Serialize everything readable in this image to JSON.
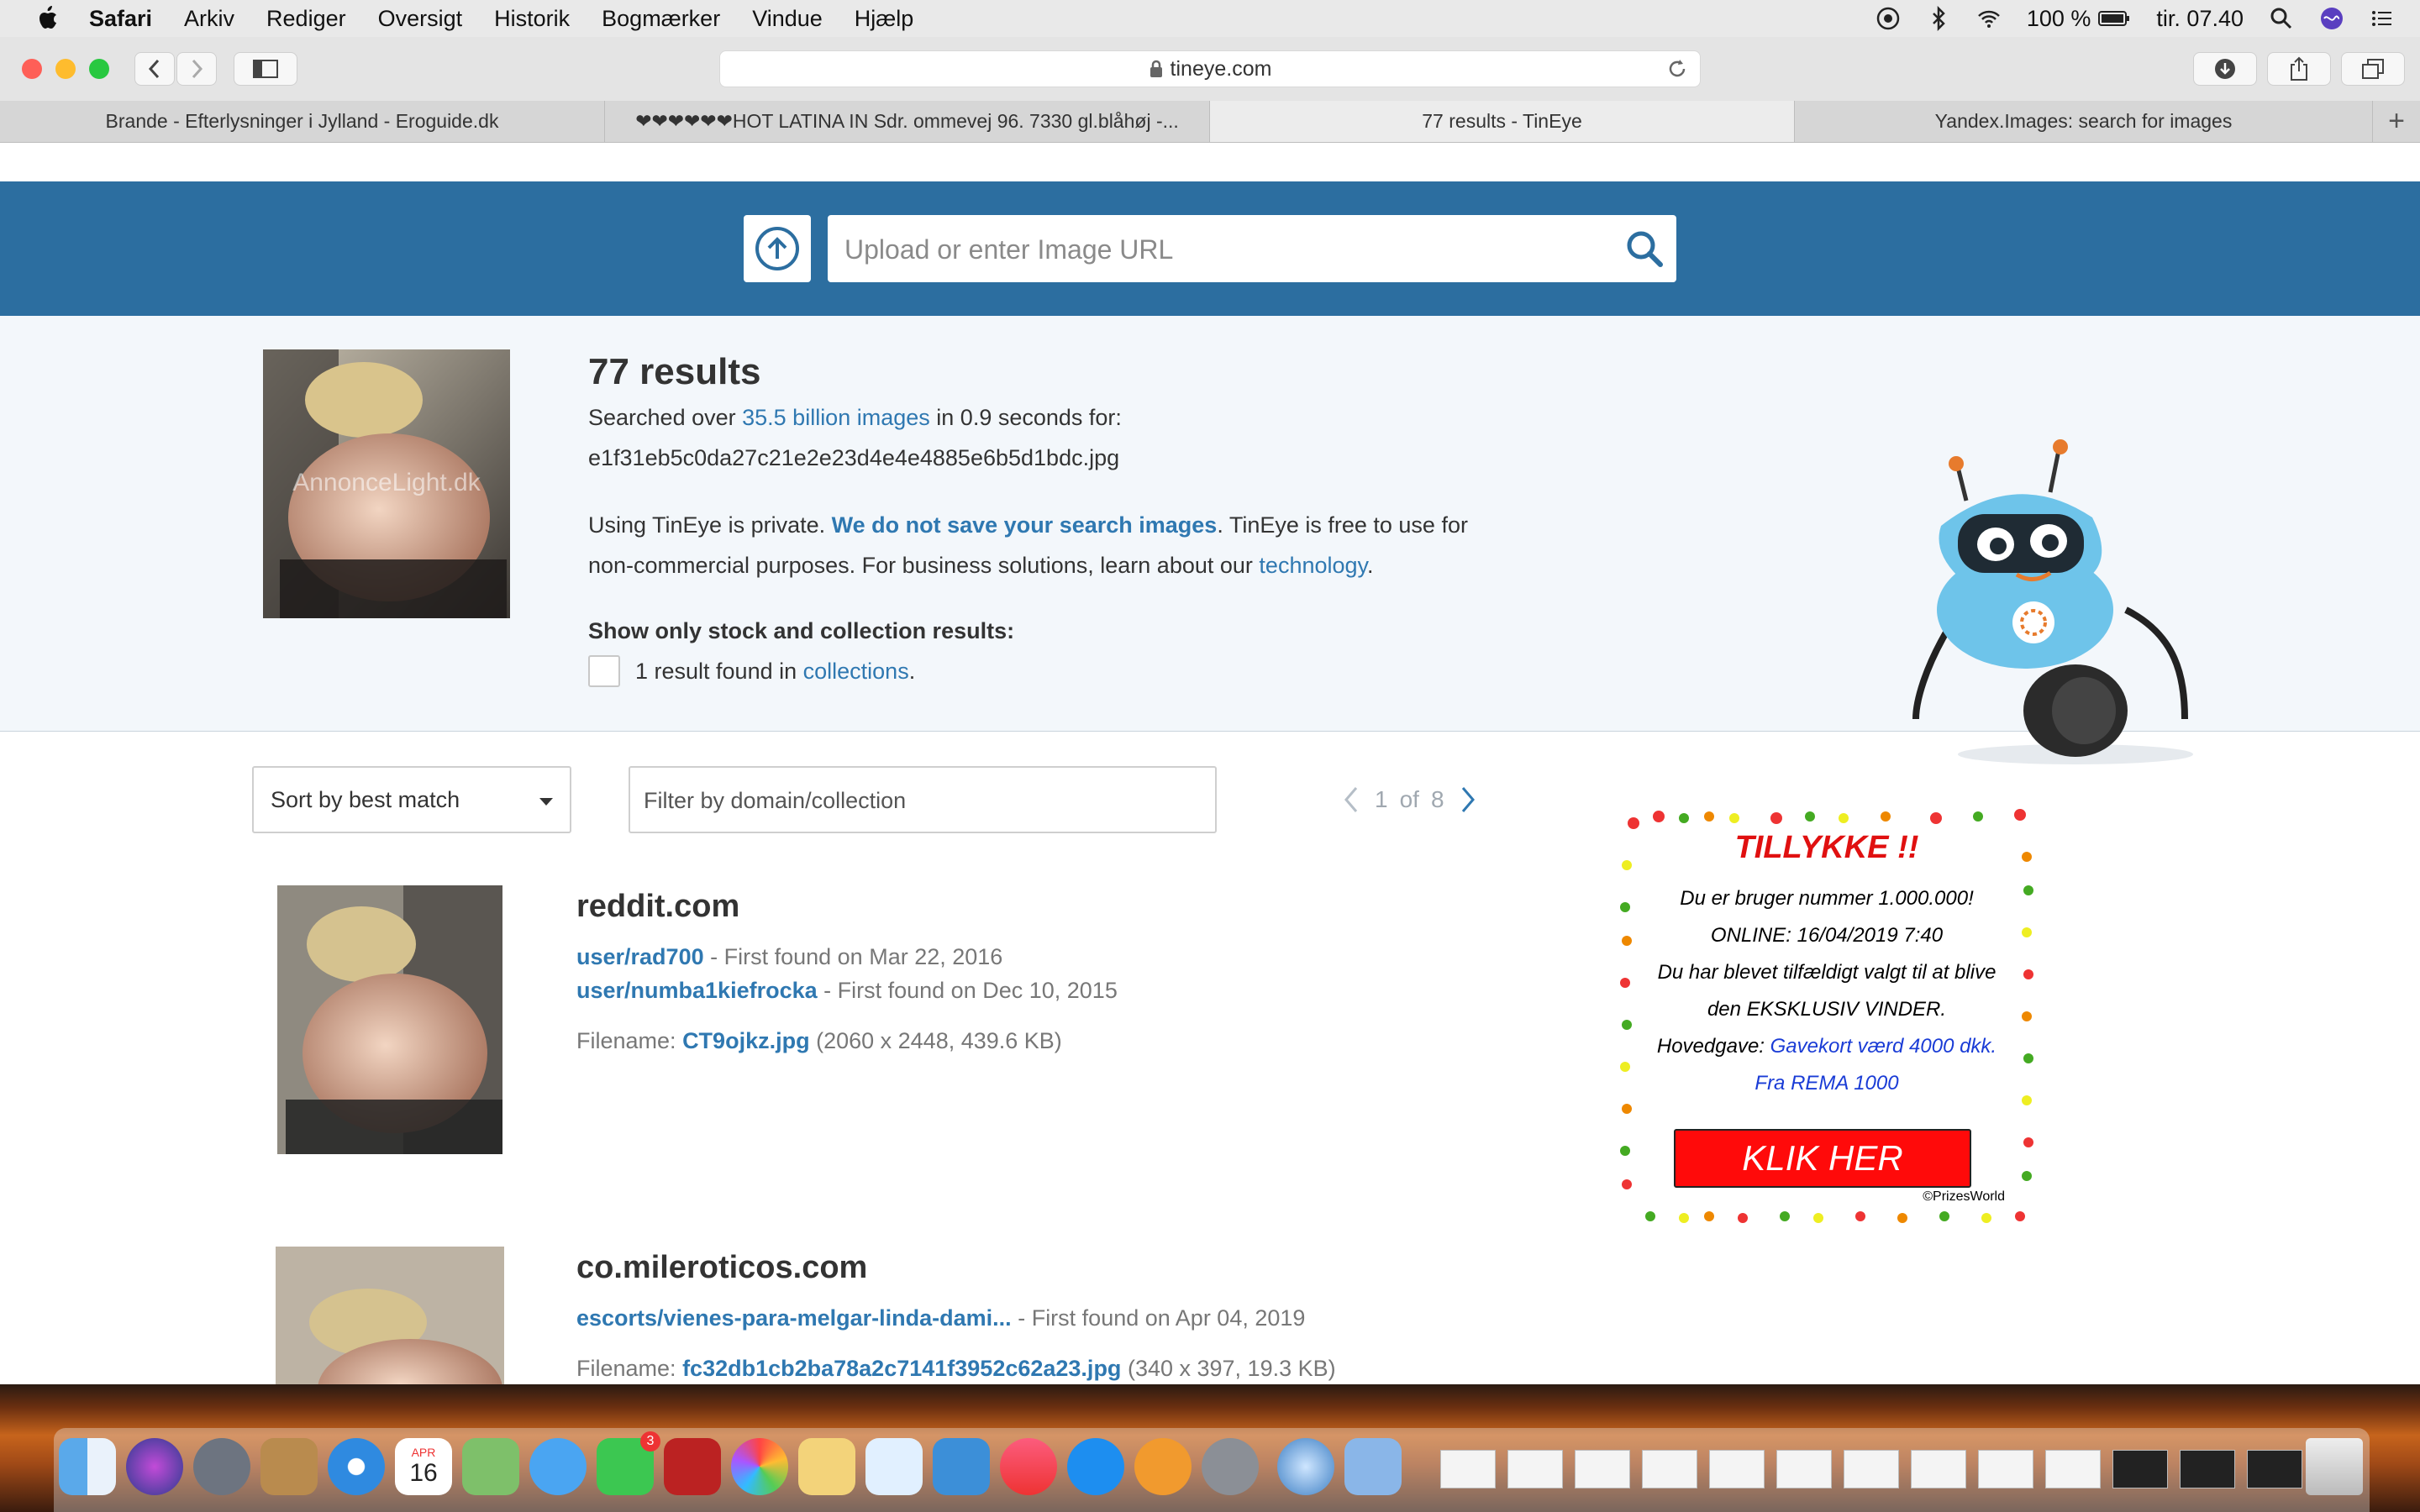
{
  "menubar": {
    "app": "Safari",
    "items": [
      "Arkiv",
      "Rediger",
      "Oversigt",
      "Historik",
      "Bogmærker",
      "Vindue",
      "Hjælp"
    ],
    "battery": "100 %",
    "clock": "tir. 07.40"
  },
  "browser": {
    "url": "tineye.com",
    "tabs": [
      "Brande - Efterlysninger i Jylland - Eroguide.dk",
      "❤❤❤❤❤❤HOT LATINA IN Sdr. ommevej 96. 7330 gl.blåhøj -...",
      "77 results - TinEye",
      "Yandex.Images: search for images"
    ],
    "active_tab": 2
  },
  "search": {
    "placeholder": "Upload or enter Image URL"
  },
  "summary": {
    "title": "77 results",
    "searched_prefix": "Searched over",
    "searched_link": "35.5 billion images",
    "searched_suffix": "in 0.9 seconds for:",
    "filename": "e1f31eb5c0da27c21e2e23d4e4e4885e6b5d1bdc.jpg",
    "privacy_1": "Using TinEye is private.",
    "privacy_link": "We do not save your search images",
    "privacy_2": ". TinEye is free to use for",
    "privacy_3": "non-commercial purposes. For business solutions, learn about our",
    "technology_link": "technology",
    "period": ".",
    "stock_heading": "Show only stock and collection results:",
    "collections_text": "1 result found in",
    "collections_link": "collections",
    "thumb_watermark": "AnnonceLight.dk"
  },
  "controls": {
    "sort_label": "Sort by best match",
    "filter_placeholder": "Filter by domain/collection",
    "page_current": "1",
    "page_of": "of",
    "page_total": "8"
  },
  "results": [
    {
      "domain": "reddit.com",
      "matches": [
        {
          "path": "user/rad700",
          "found": "- First found on Mar 22, 2016"
        },
        {
          "path": "user/numba1kiefrocka",
          "found": "- First found on Dec 10, 2015"
        }
      ],
      "filename_label": "Filename:",
      "filename": "CT9ojkz.jpg",
      "meta": "(2060 x 2448, 439.6 KB)"
    },
    {
      "domain": "co.mileroticos.com",
      "matches": [
        {
          "path": "escorts/vienes-para-melgar-linda-dami...",
          "found": "- First found on Apr 04, 2019"
        }
      ],
      "filename_label": "Filename:",
      "filename": "fc32db1cb2ba78a2c7141f3952c62a23.jpg",
      "meta": "(340 x 397, 19.3 KB)"
    }
  ],
  "ad": {
    "title": "TILLYKKE !!",
    "line1": "Du er bruger nummer 1.000.000!",
    "line2": "ONLINE: 16/04/2019 7:40",
    "line3": "Du har blevet tilfældigt valgt til at blive",
    "line4": "den EKSKLUSIV VINDER.",
    "prize_label": "Hovedgave:",
    "prize_link": "Gavekort værd 4000 dkk.",
    "prize_link2": "Fra REMA 1000",
    "button": "KLIK HER",
    "copyright": "©PrizesWorld"
  },
  "dock": {
    "calendar_month": "APR",
    "calendar_day": "16",
    "facetime_badge": "3"
  }
}
